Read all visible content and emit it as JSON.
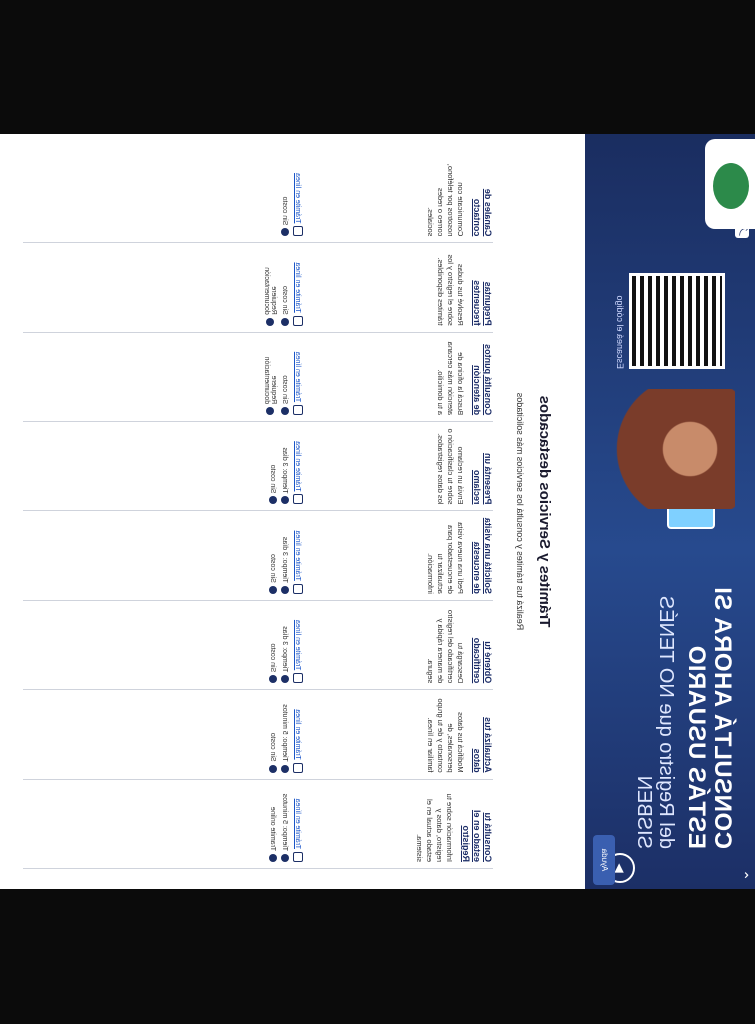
{
  "hero": {
    "title": "CONSULTÁ AHORA SI ESTÁS USUARIO",
    "subtitle": "del Registro que NO TENÉS SISBEN",
    "qr_caption": "Escaneá el código",
    "nav_labels": [
      "⌃",
      "⌄"
    ],
    "play_label": "▶",
    "bubble_label": "Ayuda"
  },
  "section": {
    "title": "Trámites y Servicios destacados",
    "intro": "Realizá tus trámites y consultá los servicios más solicitados"
  },
  "cards": [
    {
      "title": "Consultá tu estado en el Registro",
      "desc": "Información sobre tu registro, datos y estado actual en el sistema.",
      "meta": [
        "Trámite en línea",
        "Tiempo: 5 minutos",
        "Tramite online"
      ]
    },
    {
      "title": "Actualizá tus datos",
      "desc": "Modificá tus datos personales, de contacto y de tu grupo familiar en línea.",
      "meta": [
        "Trámite en línea",
        "Tiempo: 5 minutos",
        "Sin costo"
      ]
    },
    {
      "title": "Obtené tu certificado",
      "desc": "Descargá tu certificado del registro de manera rápida y segura.",
      "meta": [
        "Trámite en línea",
        "Tiempo: 3 días",
        "Sin costo"
      ]
    },
    {
      "title": "Solicitá una visita de encuesta",
      "desc": "Pedí una nueva visita de encuestador para actualizar tu información.",
      "meta": [
        "Trámite en línea",
        "Tiempo: 3 días",
        "Sin costo"
      ]
    },
    {
      "title": "Presentá un reclamo",
      "desc": "Enviá un reclamo sobre tu clasificación o los datos registrados.",
      "meta": [
        "Trámite en línea",
        "Tiempo: 3 días",
        "Sin costo"
      ]
    },
    {
      "title": "Consultá puntos de atención",
      "desc": "Buscá la oficina de atención más cercana a tu domicilio.",
      "meta": [
        "Trámite en línea",
        "Sin costo",
        "Requiere documentación"
      ]
    },
    {
      "title": "Preguntas frecuentes",
      "desc": "Resolvé tus dudas sobre el registro y los trámites disponibles.",
      "meta": [
        "Trámite en línea",
        "Sin costo",
        "Requiere documentación"
      ]
    },
    {
      "title": "Canales de contacto",
      "desc": "Comunicate con nosotros por teléfono, correo o redes sociales.",
      "meta": [
        "Trámite en línea",
        "Sin costo"
      ]
    }
  ]
}
